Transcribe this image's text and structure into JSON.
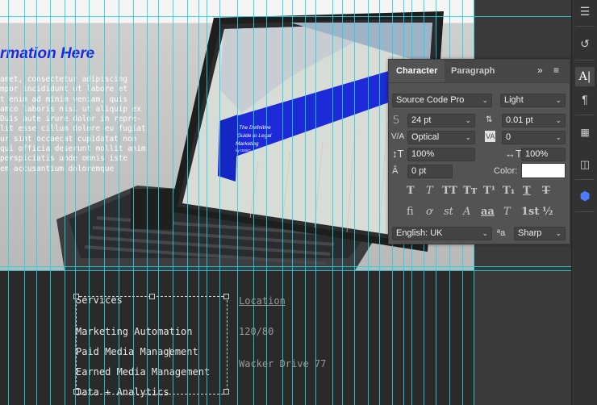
{
  "canvas": {
    "headline": "rmation Here",
    "lorem_lines": [
      "amet, consectetur adipiscing",
      "mpor incididunt ut labore et",
      "t enim ad minim veniam, quis",
      "amco laboris nisi ut aliquip ex",
      "Duis aute irure dolor in repre-",
      "lit esse cillum dolore eu fugiat",
      "ur sint occaecat cupidatat non",
      "qui officia deserunt mollit anim",
      "perspiciatis unde omnis iste",
      "em accusantium doloremque"
    ],
    "booklet": {
      "title_lines": [
        "The Definitive",
        "Guide to Legal",
        "Marketing"
      ],
      "subtitle": "by DEBO"
    },
    "footer": {
      "services_heading": "Services",
      "services": [
        "Marketing Automation",
        "Paid Media Management",
        "Earned Media Management",
        "Data + Analytics"
      ],
      "location_heading": "Location",
      "location_lines": [
        "120/80",
        "Wacker Drive 77"
      ]
    }
  },
  "panel": {
    "tabs": [
      "Character",
      "Paragraph"
    ],
    "more_label": "»",
    "menu_label": "≡",
    "font_family": "Source Code Pro",
    "font_style": "Light",
    "font_size": "24 pt",
    "leading": "0.01 pt",
    "kerning": "Optical",
    "tracking": "0",
    "vertical_scale": "100%",
    "horizontal_scale": "100%",
    "baseline_shift": "0 pt",
    "color_label": "Color:",
    "color_value": "#ffffff",
    "type_buttons_row1": [
      "T",
      "T",
      "TT",
      "Tт",
      "T¹",
      "T₁",
      "T",
      "T"
    ],
    "type_buttons_row2": [
      "fi",
      "ơ",
      "st",
      "A",
      "aa",
      "T",
      "1st",
      "½"
    ],
    "language": "English: UK",
    "aa_icon": "ªa",
    "antialias": "Sharp"
  },
  "toolbar": {
    "icons": [
      "adjustments-icon",
      "history-icon",
      "character-icon",
      "paragraph-icon",
      "glyphs-icon",
      "libraries-icon",
      "plugin-icon"
    ]
  }
}
